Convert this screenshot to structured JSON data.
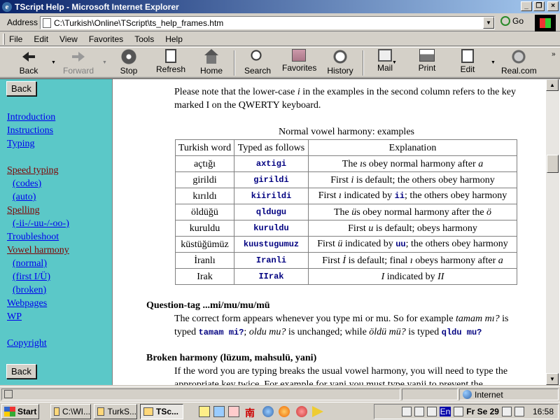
{
  "window": {
    "title": "TScript Help - Microsoft Internet Explorer"
  },
  "address": {
    "label": "Address",
    "url": "C:\\Turkish\\Online\\TScript\\ts_help_frames.htm",
    "go": "Go"
  },
  "menu": [
    "File",
    "Edit",
    "View",
    "Favorites",
    "Tools",
    "Help"
  ],
  "toolbar": {
    "back": "Back",
    "forward": "Forward",
    "stop": "Stop",
    "refresh": "Refresh",
    "home": "Home",
    "search": "Search",
    "favorites": "Favorites",
    "history": "History",
    "mail": "Mail",
    "print": "Print",
    "edit": "Edit",
    "real": "Real.com"
  },
  "nav": {
    "back_button": "Back",
    "introduction": "Introduction",
    "instructions": "Instructions",
    "typing": "Typing",
    "speed_typing": "Speed typing",
    "codes": "(codes)",
    "auto": "(auto)",
    "spelling": "Spelling",
    "ii_uu_oo": "(-ii-/-uu-/-oo-)",
    "troubleshoot": "Troubleshoot",
    "vowel_harmony": "Vowel harmony",
    "normal": "(normal)",
    "first_iu": "(first I/Ü)",
    "broken": "(broken)",
    "webpages": "Webpages",
    "wp": "WP",
    "copyright": "Copyright"
  },
  "doc": {
    "intro_1": "Please note that the lower-case ",
    "intro_i": "i",
    "intro_2": " in the examples in the second column refers to the key",
    "intro_3": "marked I on the QWERTY keyboard.",
    "table_caption": "Normal vowel harmony: examples",
    "table_headers": [
      "Turkish word",
      "Typed as follows",
      "Explanation"
    ],
    "rows": [
      {
        "word": "açtığı",
        "typed": "axtigi",
        "exp": "The ıs obey normal harmony after a"
      },
      {
        "word": "girildi",
        "typed": "girildi",
        "exp": "First i is default; the others obey harmony"
      },
      {
        "word": "kırıldı",
        "typed": "kiirildi",
        "exp": "First ı indicated by ii; the others obey harmony"
      },
      {
        "word": "öldüğü",
        "typed": "qldugu",
        "exp": "The üs obey normal harmony after the ö"
      },
      {
        "word": "kuruldu",
        "typed": "kuruldu",
        "exp": "First u is default; obeys harmony"
      },
      {
        "word": "küstüğümüz",
        "typed": "kuustugumuz",
        "exp": "First ü indicated by uu; the others obey harmony"
      },
      {
        "word": "İranlı",
        "typed": "Iranli",
        "exp": "First İ is default; final ı obeys harmony after a"
      },
      {
        "word": "Irak",
        "typed": "IIrak",
        "exp": "I indicated by II"
      }
    ],
    "qtag_heading": "Question-tag ...mi/mu/mu/mü",
    "qtag_1": "The correct form appears whenever you type mi or mu. So for example ",
    "qtag_ex1": "tamam mı?",
    "qtag_2": " is",
    "qtag_3": "typed ",
    "qtag_code1": "tamam mi?",
    "qtag_4": "; ",
    "qtag_ex2": "oldu mu?",
    "qtag_5": " is unchanged; while ",
    "qtag_ex3": "öldü mü?",
    "qtag_6": " is typed ",
    "qtag_code2": "qldu mu?",
    "broken_heading": "Broken harmony (lüzum, mahsulü, yani)",
    "broken_1": "If the word you are typing breaks the usual vowel harmony, you will need to type the",
    "broken_2": "appropriate key twice. For example for yani you must type yanii to prevent the"
  },
  "status": {
    "zone": "Internet"
  },
  "taskbar": {
    "start": "Start",
    "tasks": [
      "C:\\WI...",
      "TurkS...",
      "TSc..."
    ],
    "lang": "En",
    "date": "Fr Se 29",
    "clock": "16:58"
  }
}
